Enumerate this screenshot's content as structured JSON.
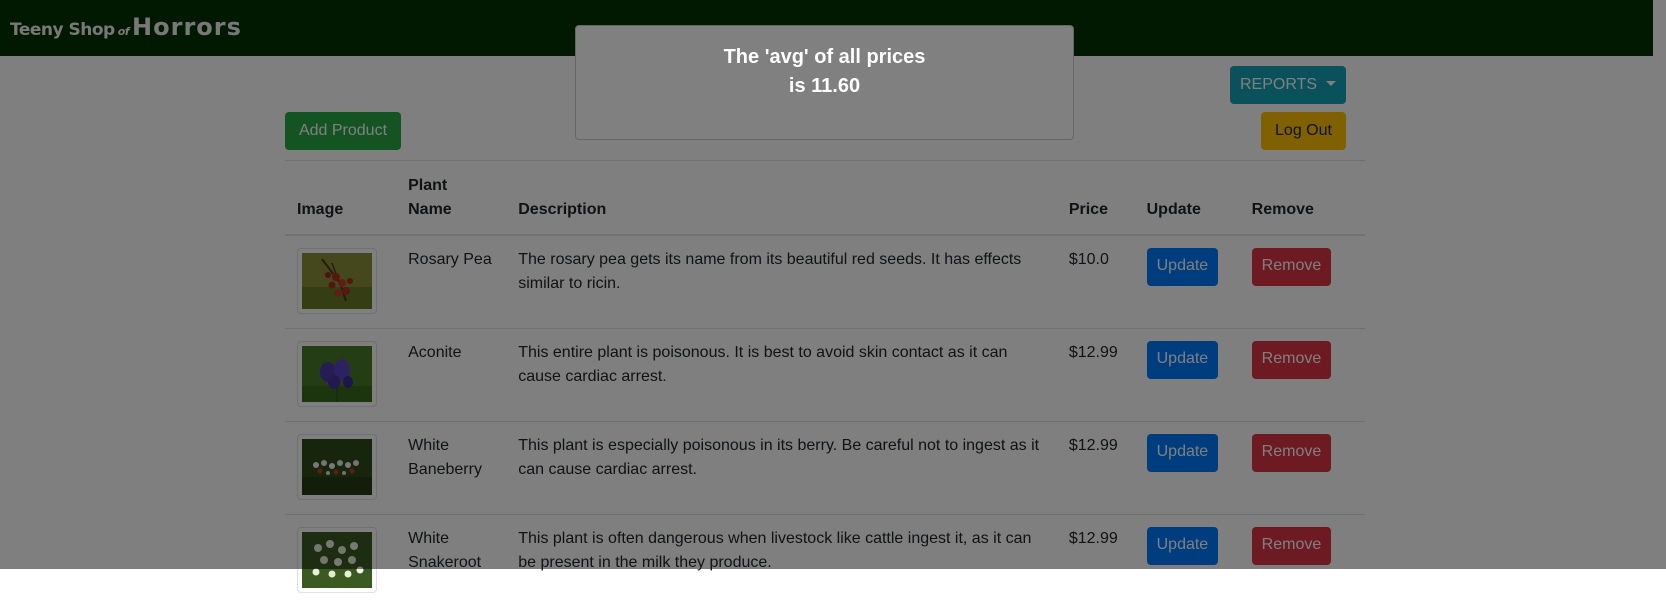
{
  "header": {
    "logo": {
      "part1": "Teeny Shop",
      "part2": "of",
      "part3": "Horrors"
    }
  },
  "toolbar": {
    "reports_label": "REPORTS",
    "add_product_label": "Add Product",
    "logout_label": "Log Out"
  },
  "table": {
    "headers": {
      "image": "Image",
      "name": "Plant Name",
      "description": "Description",
      "price": "Price",
      "update": "Update",
      "remove": "Remove"
    },
    "rows": [
      {
        "name": "Rosary Pea",
        "description": "The rosary pea gets its name from its beautiful red seeds. It has effects similar to ricin.",
        "price": "$10.0",
        "update_label": "Update",
        "remove_label": "Remove"
      },
      {
        "name": "Aconite",
        "description": "This entire plant is poisonous. It is best to avoid skin contact as it can cause cardiac arrest.",
        "price": "$12.99",
        "update_label": "Update",
        "remove_label": "Remove"
      },
      {
        "name": "White Baneberry",
        "description": "This plant is especially poisonous in its berry. Be careful not to ingest as it can cause cardiac arrest.",
        "price": "$12.99",
        "update_label": "Update",
        "remove_label": "Remove"
      },
      {
        "name": "White Snakeroot",
        "description": "This plant is often dangerous when livestock like cattle ingest it, as it can be present in the milk they produce.",
        "price": "$12.99",
        "update_label": "Update",
        "remove_label": "Remove"
      }
    ]
  },
  "modal": {
    "line1": "The 'avg' of all prices",
    "line2": "is 11.60"
  },
  "colors": {
    "navbar_bg": "#003300",
    "info": "#17a2b8",
    "success": "#28a745",
    "warning": "#ffc107",
    "primary": "#007bff",
    "danger": "#dc3545"
  },
  "icons": {
    "reports_caret": "caret-down-icon"
  }
}
